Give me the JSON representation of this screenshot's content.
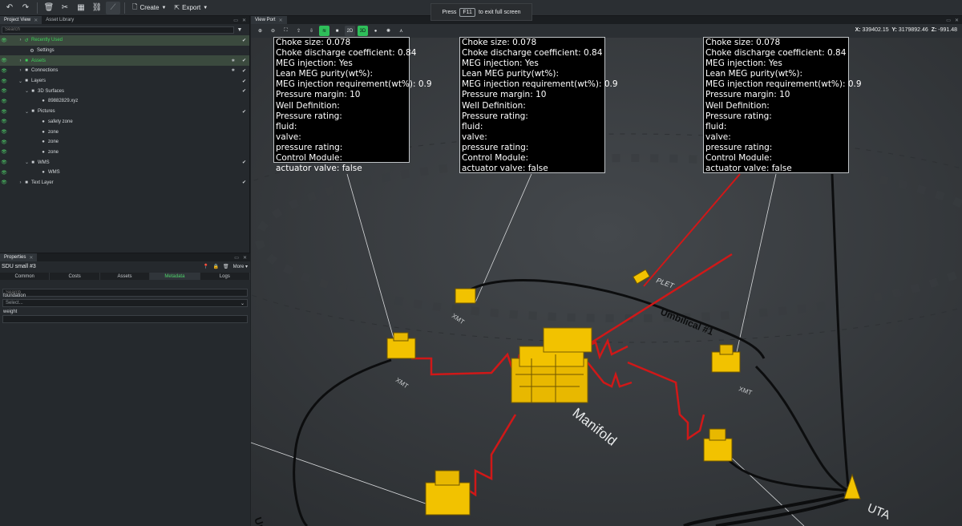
{
  "toolbar": {
    "undo_icon": "undo-icon",
    "redo_icon": "redo-icon",
    "delete_icon": "trash-icon",
    "cut_icon": "scissors-icon",
    "create_label": "Create",
    "export_label": "Export"
  },
  "fullscreen_hint": {
    "prefix": "Press",
    "key": "F11",
    "suffix": "to exit full screen"
  },
  "left_tabs": {
    "project_view": "Project View",
    "asset_library": "Asset Library"
  },
  "tree_search_placeholder": "Search",
  "tree": [
    {
      "label": "Recently Used",
      "green": true,
      "checked": true
    },
    {
      "label": "Settings"
    },
    {
      "label": "Assets",
      "green": true
    },
    {
      "label": "Connections",
      "checked": true
    },
    {
      "label": "Layers",
      "checked": true
    },
    {
      "label": "3D Surfaces",
      "checked": true
    },
    {
      "label": "89882829.xyz"
    },
    {
      "label": "Pictures",
      "checked": true
    },
    {
      "label": "safety zone"
    },
    {
      "label": "zone"
    },
    {
      "label": "zone"
    },
    {
      "label": "zone"
    },
    {
      "label": "WMS",
      "checked": true
    },
    {
      "label": "WMS"
    },
    {
      "label": "Text Layer",
      "checked": true
    }
  ],
  "properties": {
    "tab_label": "Properties",
    "object_name": "SDU small #3",
    "more_label": "More",
    "tabs": [
      "Common",
      "Costs",
      "Assets",
      "Metadata",
      "Logs"
    ],
    "active_tab": "Metadata",
    "search_placeholder": "Search",
    "foundation_label": "foundation",
    "foundation_placeholder": "Select...",
    "weight_label": "weight"
  },
  "viewport": {
    "tab_label": "View Port",
    "mode_2d": "2D",
    "mode_3d": "3D",
    "coords": {
      "x_label": "X:",
      "x": "339402.15",
      "y_label": "Y:",
      "y": "3179892.46",
      "z_label": "Z:",
      "z": "-991.48"
    }
  },
  "info_box_lines": [
    "Choke size: 0.078",
    "Choke discharge coefficient: 0.84",
    "MEG injection: Yes",
    "Lean MEG purity(wt%):",
    "MEG injection requirement(wt%): 0.9",
    "Pressure margin: 10",
    "Well Definition:",
    "Pressure rating:",
    "fluid:",
    "valve:",
    "pressure rating:",
    "Control Module:",
    "actuator valve: false"
  ],
  "scene_labels": {
    "manifold": "Manifold",
    "uta": "UTA",
    "plet": "PLET",
    "umbilical": "Umbilical #1",
    "umbilical_left": "Umb",
    "xmt": "XMT"
  },
  "colors": {
    "accent_green": "#2fbf5a",
    "flowline_red": "#d01818",
    "equipment_yellow": "#f2c200",
    "seabed": "#3a3d41"
  }
}
